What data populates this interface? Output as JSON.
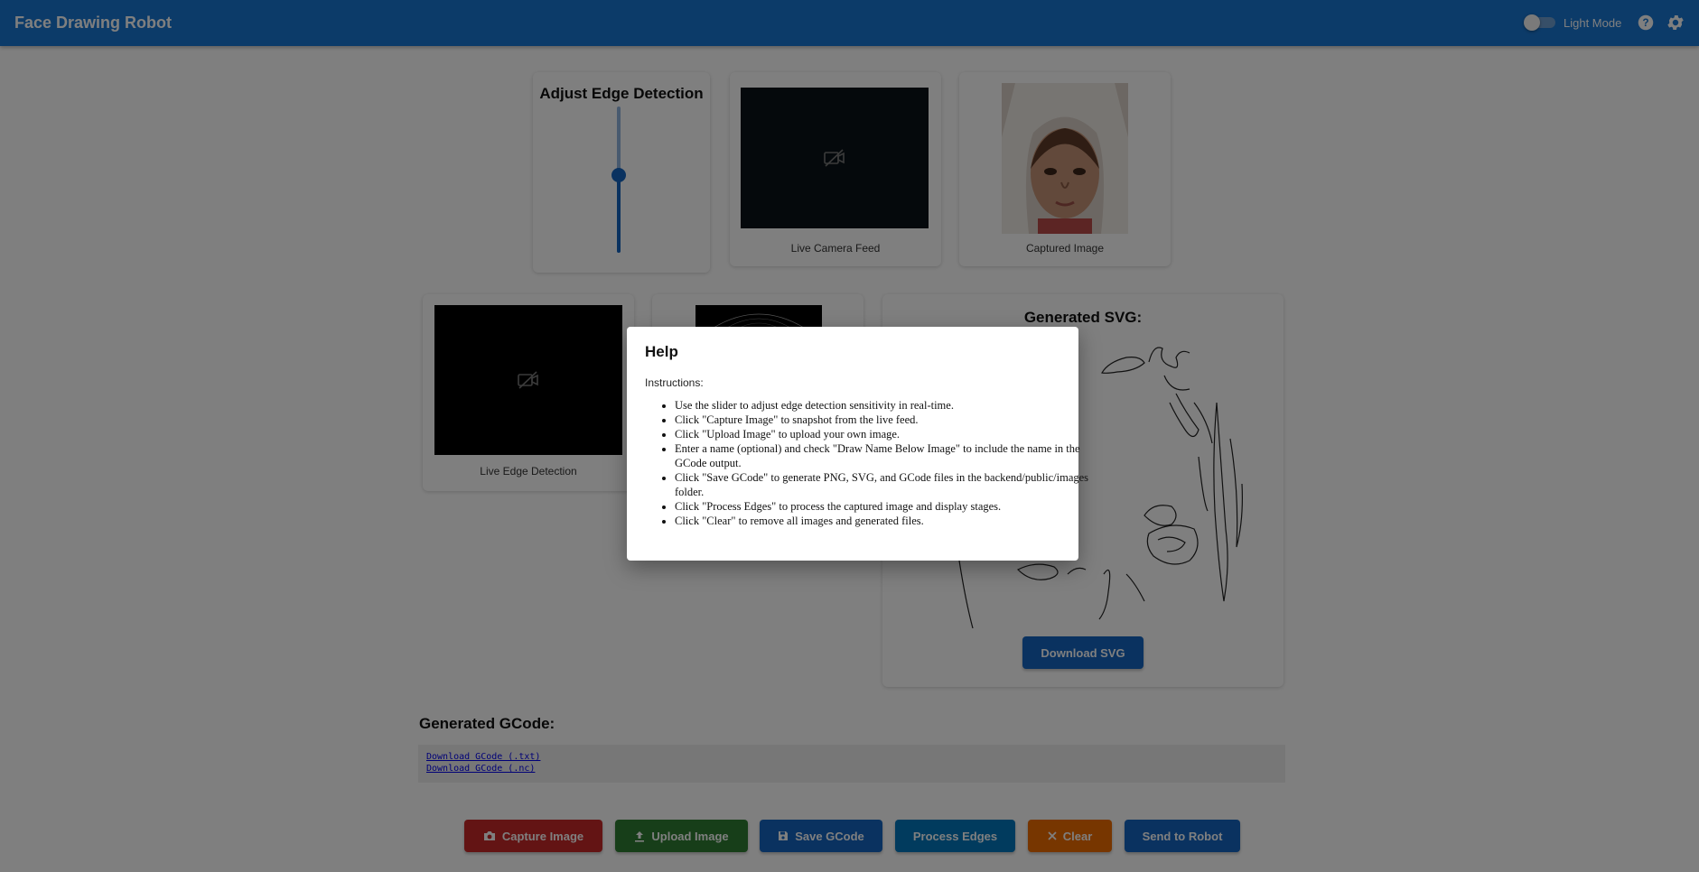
{
  "app": {
    "title": "Face Drawing Robot",
    "theme_toggle_label": "Light Mode"
  },
  "slider": {
    "title": "Adjust Edge Detection",
    "value_fraction": 0.45
  },
  "cards": {
    "live_camera": "Live Camera Feed",
    "captured": "Captured Image",
    "live_edge": "Live Edge Detection",
    "svg_title": "Generated SVG:"
  },
  "svg_download": "Download SVG",
  "gcode": {
    "title": "Generated GCode:",
    "links": [
      "Download GCode (.txt)",
      "Download GCode (.nc)"
    ]
  },
  "buttons": {
    "capture": "Capture Image",
    "upload": "Upload Image",
    "save": "Save GCode",
    "process": "Process Edges",
    "clear": "Clear",
    "send": "Send to Robot"
  },
  "colors": {
    "appbar": "#1976d2",
    "capture": "#c62828",
    "upload": "#2e7d32",
    "save": "#1565c0",
    "process": "#0277bd",
    "clear": "#ef6c00",
    "send": "#1565c0"
  },
  "help": {
    "title": "Help",
    "subtitle": "Instructions:",
    "items": [
      "Use the slider to adjust edge detection sensitivity in real-time.",
      "Click \"Capture Image\" to snapshot from the live feed.",
      "Click \"Upload Image\" to upload your own image.",
      "Enter a name (optional) and check \"Draw Name Below Image\" to include the name in the GCode output.",
      "Click \"Save GCode\" to generate PNG, SVG, and GCode files in the backend/public/images folder.",
      "Click \"Process Edges\" to process the captured image and display stages.",
      "Click \"Clear\" to remove all images and generated files."
    ]
  }
}
